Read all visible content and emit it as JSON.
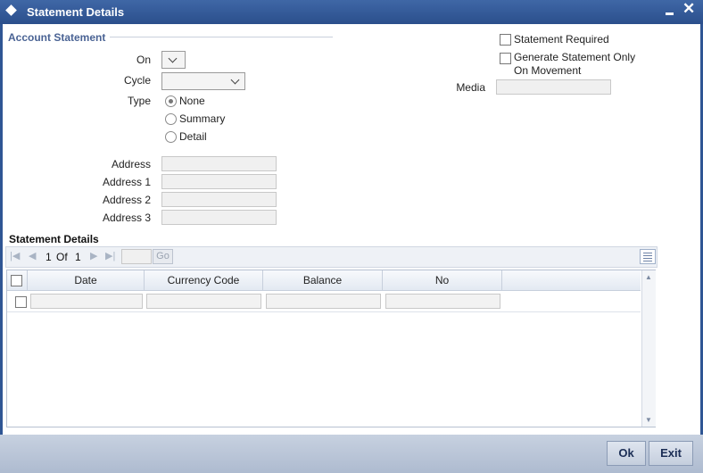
{
  "window": {
    "title": "Statement Details",
    "minimize_label": "minimize",
    "close_glyph": "✕"
  },
  "account_statement": {
    "legend": "Account Statement",
    "on_label": "On",
    "cycle_label": "Cycle",
    "type_label": "Type",
    "type_options": [
      "None",
      "Summary",
      "Detail"
    ],
    "type_selected": "None",
    "statement_required_label": "Statement Required",
    "generate_on_movement_line1": "Generate Statement Only",
    "generate_on_movement_line2": "On Movement",
    "media_label": "Media",
    "address_label": "Address",
    "address1_label": "Address 1",
    "address2_label": "Address 2",
    "address3_label": "Address 3"
  },
  "statement_details": {
    "heading": "Statement Details",
    "pager": {
      "current": "1",
      "of_label": "Of",
      "total": "1",
      "go_label": "Go"
    },
    "columns": [
      "Date",
      "Currency Code",
      "Balance",
      "No"
    ]
  },
  "footer": {
    "ok_label": "Ok",
    "exit_label": "Exit"
  },
  "colors": {
    "title_bar": "#2f5694",
    "footer_bar": "#b8c4d6",
    "legend_text": "#4a6394"
  }
}
